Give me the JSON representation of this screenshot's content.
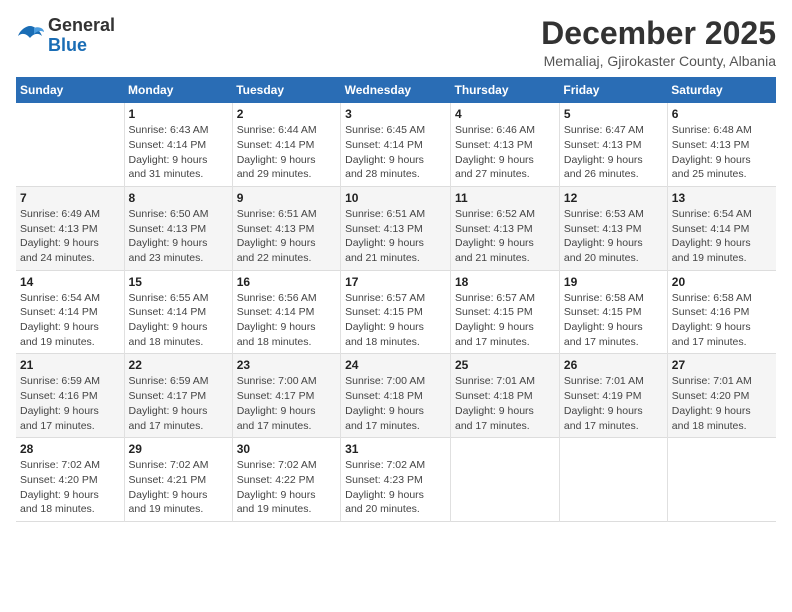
{
  "logo": {
    "general": "General",
    "blue": "Blue"
  },
  "title": "December 2025",
  "subtitle": "Memaliaj, Gjirokaster County, Albania",
  "days_header": [
    "Sunday",
    "Monday",
    "Tuesday",
    "Wednesday",
    "Thursday",
    "Friday",
    "Saturday"
  ],
  "weeks": [
    [
      {
        "num": "",
        "info": ""
      },
      {
        "num": "1",
        "info": "Sunrise: 6:43 AM\nSunset: 4:14 PM\nDaylight: 9 hours\nand 31 minutes."
      },
      {
        "num": "2",
        "info": "Sunrise: 6:44 AM\nSunset: 4:14 PM\nDaylight: 9 hours\nand 29 minutes."
      },
      {
        "num": "3",
        "info": "Sunrise: 6:45 AM\nSunset: 4:14 PM\nDaylight: 9 hours\nand 28 minutes."
      },
      {
        "num": "4",
        "info": "Sunrise: 6:46 AM\nSunset: 4:13 PM\nDaylight: 9 hours\nand 27 minutes."
      },
      {
        "num": "5",
        "info": "Sunrise: 6:47 AM\nSunset: 4:13 PM\nDaylight: 9 hours\nand 26 minutes."
      },
      {
        "num": "6",
        "info": "Sunrise: 6:48 AM\nSunset: 4:13 PM\nDaylight: 9 hours\nand 25 minutes."
      }
    ],
    [
      {
        "num": "7",
        "info": "Sunrise: 6:49 AM\nSunset: 4:13 PM\nDaylight: 9 hours\nand 24 minutes."
      },
      {
        "num": "8",
        "info": "Sunrise: 6:50 AM\nSunset: 4:13 PM\nDaylight: 9 hours\nand 23 minutes."
      },
      {
        "num": "9",
        "info": "Sunrise: 6:51 AM\nSunset: 4:13 PM\nDaylight: 9 hours\nand 22 minutes."
      },
      {
        "num": "10",
        "info": "Sunrise: 6:51 AM\nSunset: 4:13 PM\nDaylight: 9 hours\nand 21 minutes."
      },
      {
        "num": "11",
        "info": "Sunrise: 6:52 AM\nSunset: 4:13 PM\nDaylight: 9 hours\nand 21 minutes."
      },
      {
        "num": "12",
        "info": "Sunrise: 6:53 AM\nSunset: 4:13 PM\nDaylight: 9 hours\nand 20 minutes."
      },
      {
        "num": "13",
        "info": "Sunrise: 6:54 AM\nSunset: 4:14 PM\nDaylight: 9 hours\nand 19 minutes."
      }
    ],
    [
      {
        "num": "14",
        "info": "Sunrise: 6:54 AM\nSunset: 4:14 PM\nDaylight: 9 hours\nand 19 minutes."
      },
      {
        "num": "15",
        "info": "Sunrise: 6:55 AM\nSunset: 4:14 PM\nDaylight: 9 hours\nand 18 minutes."
      },
      {
        "num": "16",
        "info": "Sunrise: 6:56 AM\nSunset: 4:14 PM\nDaylight: 9 hours\nand 18 minutes."
      },
      {
        "num": "17",
        "info": "Sunrise: 6:57 AM\nSunset: 4:15 PM\nDaylight: 9 hours\nand 18 minutes."
      },
      {
        "num": "18",
        "info": "Sunrise: 6:57 AM\nSunset: 4:15 PM\nDaylight: 9 hours\nand 17 minutes."
      },
      {
        "num": "19",
        "info": "Sunrise: 6:58 AM\nSunset: 4:15 PM\nDaylight: 9 hours\nand 17 minutes."
      },
      {
        "num": "20",
        "info": "Sunrise: 6:58 AM\nSunset: 4:16 PM\nDaylight: 9 hours\nand 17 minutes."
      }
    ],
    [
      {
        "num": "21",
        "info": "Sunrise: 6:59 AM\nSunset: 4:16 PM\nDaylight: 9 hours\nand 17 minutes."
      },
      {
        "num": "22",
        "info": "Sunrise: 6:59 AM\nSunset: 4:17 PM\nDaylight: 9 hours\nand 17 minutes."
      },
      {
        "num": "23",
        "info": "Sunrise: 7:00 AM\nSunset: 4:17 PM\nDaylight: 9 hours\nand 17 minutes."
      },
      {
        "num": "24",
        "info": "Sunrise: 7:00 AM\nSunset: 4:18 PM\nDaylight: 9 hours\nand 17 minutes."
      },
      {
        "num": "25",
        "info": "Sunrise: 7:01 AM\nSunset: 4:18 PM\nDaylight: 9 hours\nand 17 minutes."
      },
      {
        "num": "26",
        "info": "Sunrise: 7:01 AM\nSunset: 4:19 PM\nDaylight: 9 hours\nand 17 minutes."
      },
      {
        "num": "27",
        "info": "Sunrise: 7:01 AM\nSunset: 4:20 PM\nDaylight: 9 hours\nand 18 minutes."
      }
    ],
    [
      {
        "num": "28",
        "info": "Sunrise: 7:02 AM\nSunset: 4:20 PM\nDaylight: 9 hours\nand 18 minutes."
      },
      {
        "num": "29",
        "info": "Sunrise: 7:02 AM\nSunset: 4:21 PM\nDaylight: 9 hours\nand 19 minutes."
      },
      {
        "num": "30",
        "info": "Sunrise: 7:02 AM\nSunset: 4:22 PM\nDaylight: 9 hours\nand 19 minutes."
      },
      {
        "num": "31",
        "info": "Sunrise: 7:02 AM\nSunset: 4:23 PM\nDaylight: 9 hours\nand 20 minutes."
      },
      {
        "num": "",
        "info": ""
      },
      {
        "num": "",
        "info": ""
      },
      {
        "num": "",
        "info": ""
      }
    ]
  ]
}
